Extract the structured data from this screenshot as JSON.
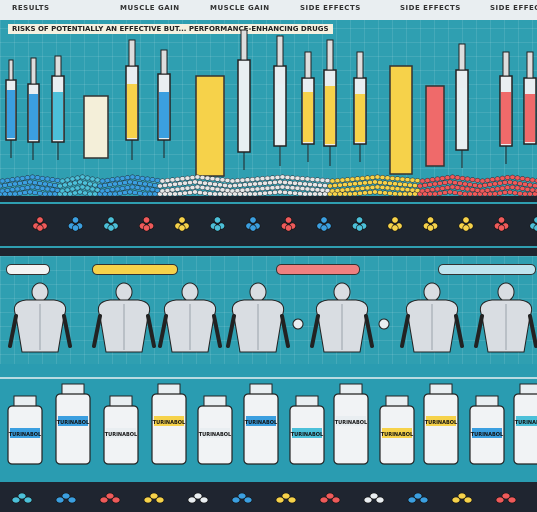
{
  "header": {
    "col_labels": [
      "RESULTS",
      "MUSCLE GAIN",
      "MUSCLE GAIN",
      "SIDE EFFECTS",
      "SIDE EFFECTS",
      "SIDE EFFECTS"
    ],
    "subtitle": "RISKS OF POTENTIALLY AN EFFECTIVE BUT... PERFORMANCE-ENHANCING DRUGS"
  },
  "vials": {
    "labels": [
      "TURINABOL",
      "TURINABOL",
      "TURINABOL",
      "TURINABOL",
      "TURINABOL",
      "TURINABOL",
      "TURINABOL",
      "TURINABOL",
      "TURINABOL",
      "TURINABOL",
      "TURINABOL",
      "TURINABOL"
    ]
  },
  "colors": {
    "teal": "#2f9fb1",
    "dark": "#1e252f",
    "yellow": "#f6d24a",
    "red": "#ef5a5a",
    "blue": "#3b9fe0",
    "cream": "#f4efd9"
  }
}
